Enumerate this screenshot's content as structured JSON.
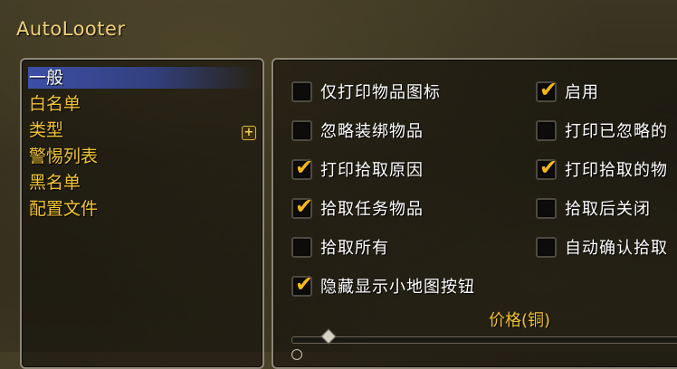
{
  "window": {
    "title": "AutoLooter"
  },
  "categories": [
    {
      "label": "一般",
      "selected": true
    },
    {
      "label": "白名单",
      "selected": false
    },
    {
      "label": "类型",
      "selected": false
    },
    {
      "label": "警惕列表",
      "selected": false
    },
    {
      "label": "黑名单",
      "selected": false
    },
    {
      "label": "配置文件",
      "selected": false
    }
  ],
  "expand_label": "+",
  "options": {
    "left": [
      {
        "label": "仅打印物品图标",
        "checked": false
      },
      {
        "label": "忽略装绑物品",
        "checked": false
      },
      {
        "label": "打印拾取原因",
        "checked": true
      },
      {
        "label": "拾取任务物品",
        "checked": true
      },
      {
        "label": "拾取所有",
        "checked": false
      },
      {
        "label": "隐藏显示小地图按钮",
        "checked": true
      }
    ],
    "right": [
      {
        "label": "启用",
        "checked": true
      },
      {
        "label": "打印已忽略的",
        "checked": false
      },
      {
        "label": "打印拾取的物",
        "checked": true
      },
      {
        "label": "拾取后关闭",
        "checked": false
      },
      {
        "label": "自动确认拾取",
        "checked": false
      }
    ]
  },
  "price": {
    "label": "价格(铜)",
    "value": 0
  },
  "colors": {
    "accent": "#f0c433",
    "selected_bg": "#3d4fa6",
    "check": "#f6b81a"
  }
}
